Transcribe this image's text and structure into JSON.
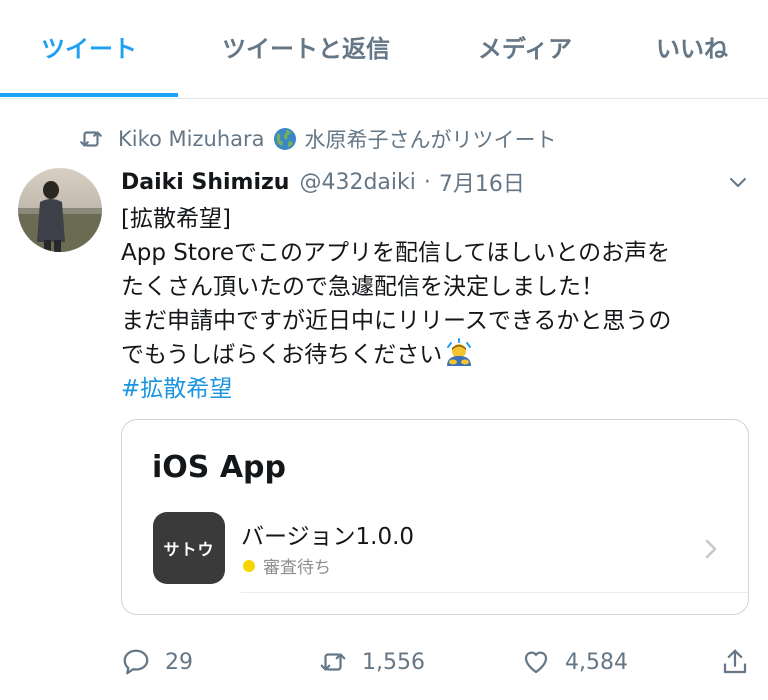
{
  "tabs": [
    {
      "label": "ツイート",
      "active": true
    },
    {
      "label": "ツイートと返信",
      "active": false
    },
    {
      "label": "メディア",
      "active": false
    },
    {
      "label": "いいね",
      "active": false
    }
  ],
  "retweet": {
    "user": "Kiko Mizuhara",
    "suffix": "水原希子さんがリツイート",
    "icon": "retweet-icon"
  },
  "tweet": {
    "author_name": "Daiki Shimizu",
    "handle": "@432daiki",
    "separator": "·",
    "date": "7月16日",
    "lines": [
      "[拡散希望]",
      "App Storeでこのアプリを配信してほしいとのお声を",
      "たくさん頂いたので急遽配信を決定しました！",
      "まだ申請中ですが近日中にリリースできるかと思うの",
      "でもうしばらくお待ちください"
    ],
    "hashtag": "#拡散希望"
  },
  "card": {
    "title": "iOS App",
    "app_icon_text": "サトウ",
    "version": "バージョン1.0.0",
    "status": "審査待ち",
    "status_color": "#f8d500"
  },
  "actions": {
    "replies": "29",
    "retweets": "1,556",
    "likes": "4,584"
  },
  "colors": {
    "accent": "#1da1f2",
    "muted": "#657786",
    "text": "#14171a"
  }
}
